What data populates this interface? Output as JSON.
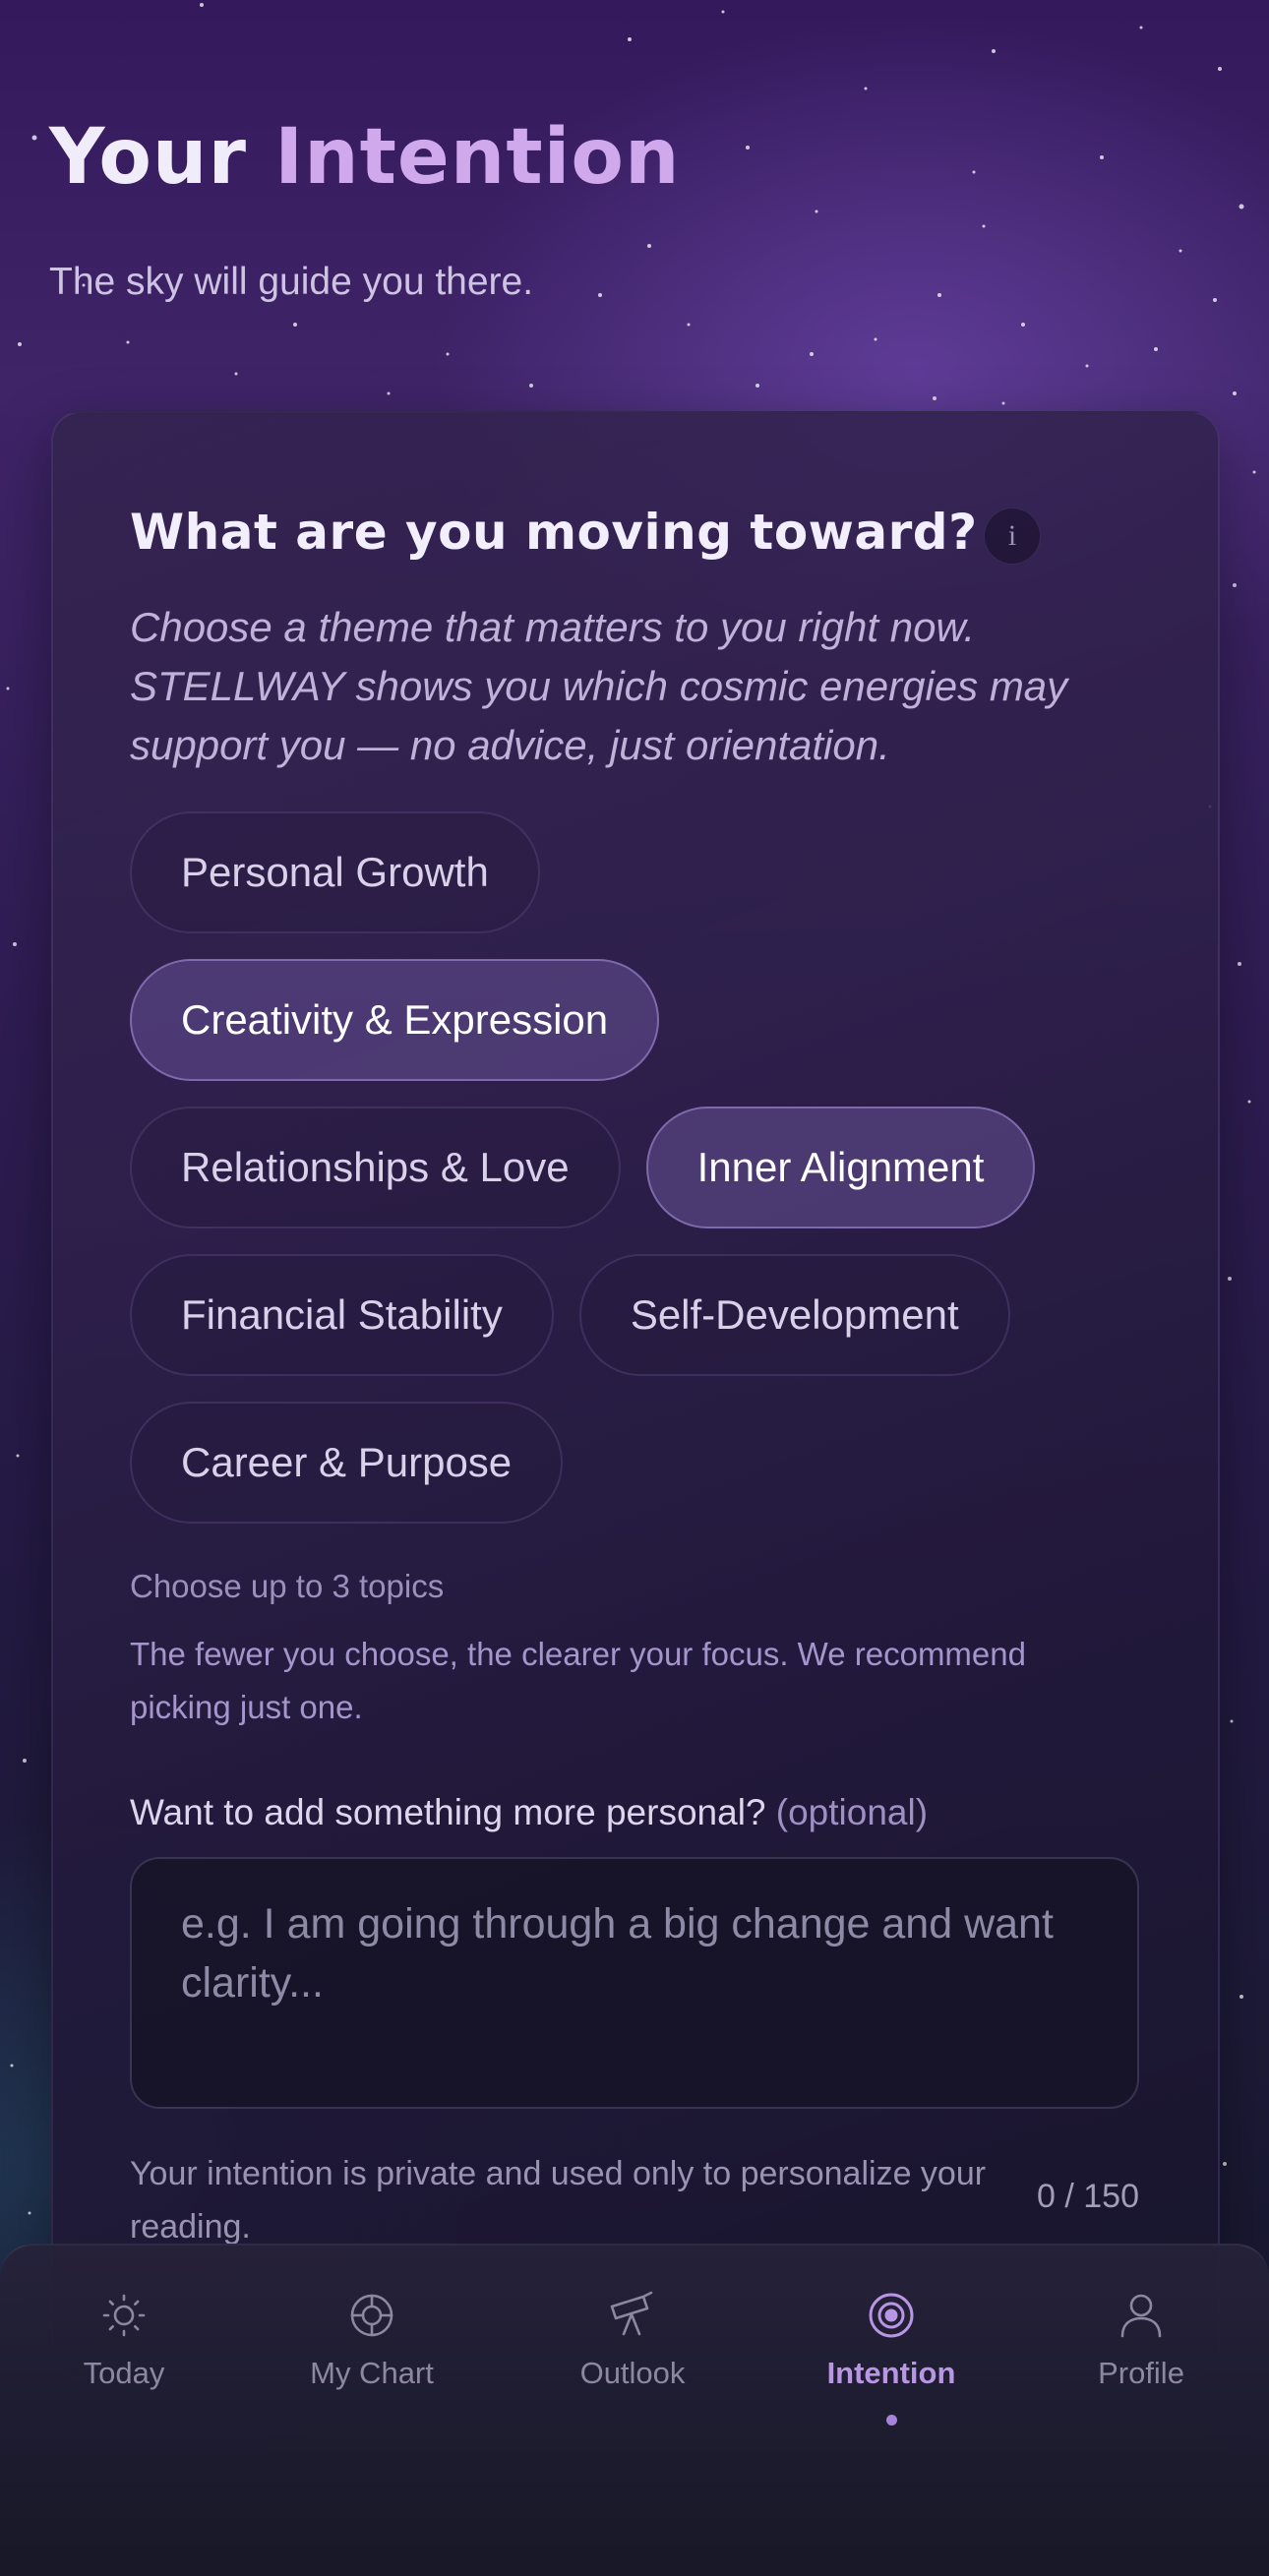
{
  "header": {
    "title_part1": "Your",
    "title_part2": "Intention",
    "subtitle": "The sky will guide you there."
  },
  "card": {
    "title": "What are you moving toward?",
    "info_icon_glyph": "i",
    "description": "Choose a theme that matters to you right now. STELLWAY shows you which cosmic energies may support you — no advice, just orientation.",
    "topics": [
      {
        "label": "Personal Growth",
        "selected": false
      },
      {
        "label": "Creativity & Expression",
        "selected": true
      },
      {
        "label": "Relationships & Love",
        "selected": false
      },
      {
        "label": "Inner Alignment",
        "selected": true
      },
      {
        "label": "Financial Stability",
        "selected": false
      },
      {
        "label": "Self-Development",
        "selected": false
      },
      {
        "label": "Career & Purpose",
        "selected": false
      }
    ],
    "hint_title": "Choose up to 3 topics",
    "hint_body": "The fewer you choose, the clearer your focus. We recommend picking just one.",
    "personal_label": "Want to add something more personal?",
    "personal_optional": "(optional)",
    "textarea_value": "",
    "textarea_placeholder": "e.g. I am going through a big change and want clarity...",
    "privacy_note": "Your intention is private and used only to personalize your reading.",
    "char_counter": "0 / 150"
  },
  "tabbar": {
    "tabs": [
      {
        "label": "Today",
        "icon": "sun-icon",
        "active": false
      },
      {
        "label": "My Chart",
        "icon": "chart-wheel-icon",
        "active": false
      },
      {
        "label": "Outlook",
        "icon": "telescope-icon",
        "active": false
      },
      {
        "label": "Intention",
        "icon": "target-icon",
        "active": true
      },
      {
        "label": "Profile",
        "icon": "user-icon",
        "active": false
      }
    ]
  },
  "colors": {
    "accent": "#d0a8ec",
    "active_tab": "#b896e4",
    "inactive_tab": "#8c88a2"
  }
}
